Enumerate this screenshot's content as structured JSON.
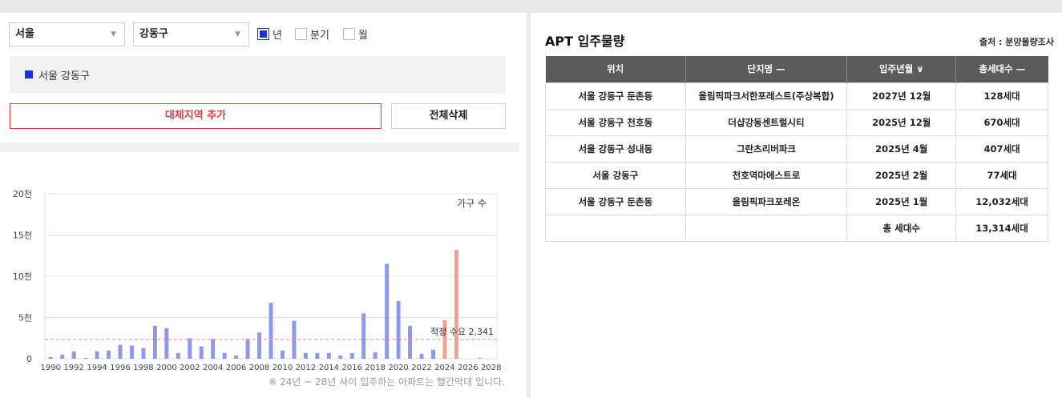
{
  "filters": {
    "city": "서울",
    "district": "강동구",
    "period_options": [
      {
        "label": "년",
        "checked": true
      },
      {
        "label": "분기",
        "checked": false
      },
      {
        "label": "월",
        "checked": false
      }
    ]
  },
  "region_list": [
    "서울 강동구"
  ],
  "buttons": {
    "add_region": "대체지역 추가",
    "delete_all": "전체삭제"
  },
  "note": "※ 24년 ~ 28년 사이 입주하는 아파트는 빨간막대 입니다.",
  "colors": {
    "series_past": "#8f98ec",
    "series_future": "#f4a091",
    "accent": "#1b2fd8",
    "add_button": "#e23a3a",
    "header_bg": "#5b5b5b"
  },
  "chart_data": {
    "type": "bar",
    "ylabel": "가구 수",
    "ylim": [
      0,
      20000
    ],
    "yticks": [
      {
        "value": 0,
        "label": "0"
      },
      {
        "value": 5000,
        "label": "5천"
      },
      {
        "value": 10000,
        "label": "10천"
      },
      {
        "value": 15000,
        "label": "15천"
      },
      {
        "value": 20000,
        "label": "20천"
      }
    ],
    "xlim": [
      1990,
      2028
    ],
    "xticks": [
      1990,
      1992,
      1994,
      1996,
      1998,
      2000,
      2002,
      2004,
      2006,
      2008,
      2010,
      2012,
      2014,
      2016,
      2018,
      2020,
      2022,
      2024,
      2026,
      2028
    ],
    "x": [
      1990,
      1991,
      1992,
      1993,
      1994,
      1995,
      1996,
      1997,
      1998,
      1999,
      2000,
      2001,
      2002,
      2003,
      2004,
      2005,
      2006,
      2007,
      2008,
      2009,
      2010,
      2011,
      2012,
      2013,
      2014,
      2015,
      2016,
      2017,
      2018,
      2019,
      2020,
      2021,
      2022,
      2023,
      2024,
      2025,
      2026,
      2027
    ],
    "values": [
      200,
      500,
      900,
      100,
      900,
      1000,
      1700,
      1600,
      1300,
      4000,
      3700,
      700,
      2500,
      1500,
      2400,
      700,
      400,
      2400,
      3200,
      6800,
      1000,
      4600,
      700,
      700,
      700,
      400,
      700,
      5500,
      800,
      11500,
      7000,
      4000,
      600,
      1100,
      4700,
      13200,
      0,
      130
    ],
    "future_from": 2024,
    "reference_line": {
      "value": 2341,
      "label": "적정 수요 2,341"
    }
  },
  "table": {
    "title": "APT 입주물량",
    "source": "출처 : 분양물량조사",
    "headers": [
      "위치",
      "단지명 —",
      "입주년월 ∨",
      "총세대수 —"
    ],
    "rows": [
      [
        "서울 강동구 둔촌동",
        "올림픽파크서한포레스트(주상복합)",
        "2027년 12월",
        "128세대"
      ],
      [
        "서울 강동구 천호동",
        "더샵강동센트럴시티",
        "2025년 12월",
        "670세대"
      ],
      [
        "서울 강동구 성내동",
        "그란츠리버파크",
        "2025년 4월",
        "407세대"
      ],
      [
        "서울 강동구",
        "천호역마에스트로",
        "2025년 2월",
        "77세대"
      ],
      [
        "서울 강동구 둔촌동",
        "올림픽파크포레온",
        "2025년 1월",
        "12,032세대"
      ],
      [
        "",
        "",
        "총 세대수",
        "13,314세대"
      ]
    ]
  }
}
